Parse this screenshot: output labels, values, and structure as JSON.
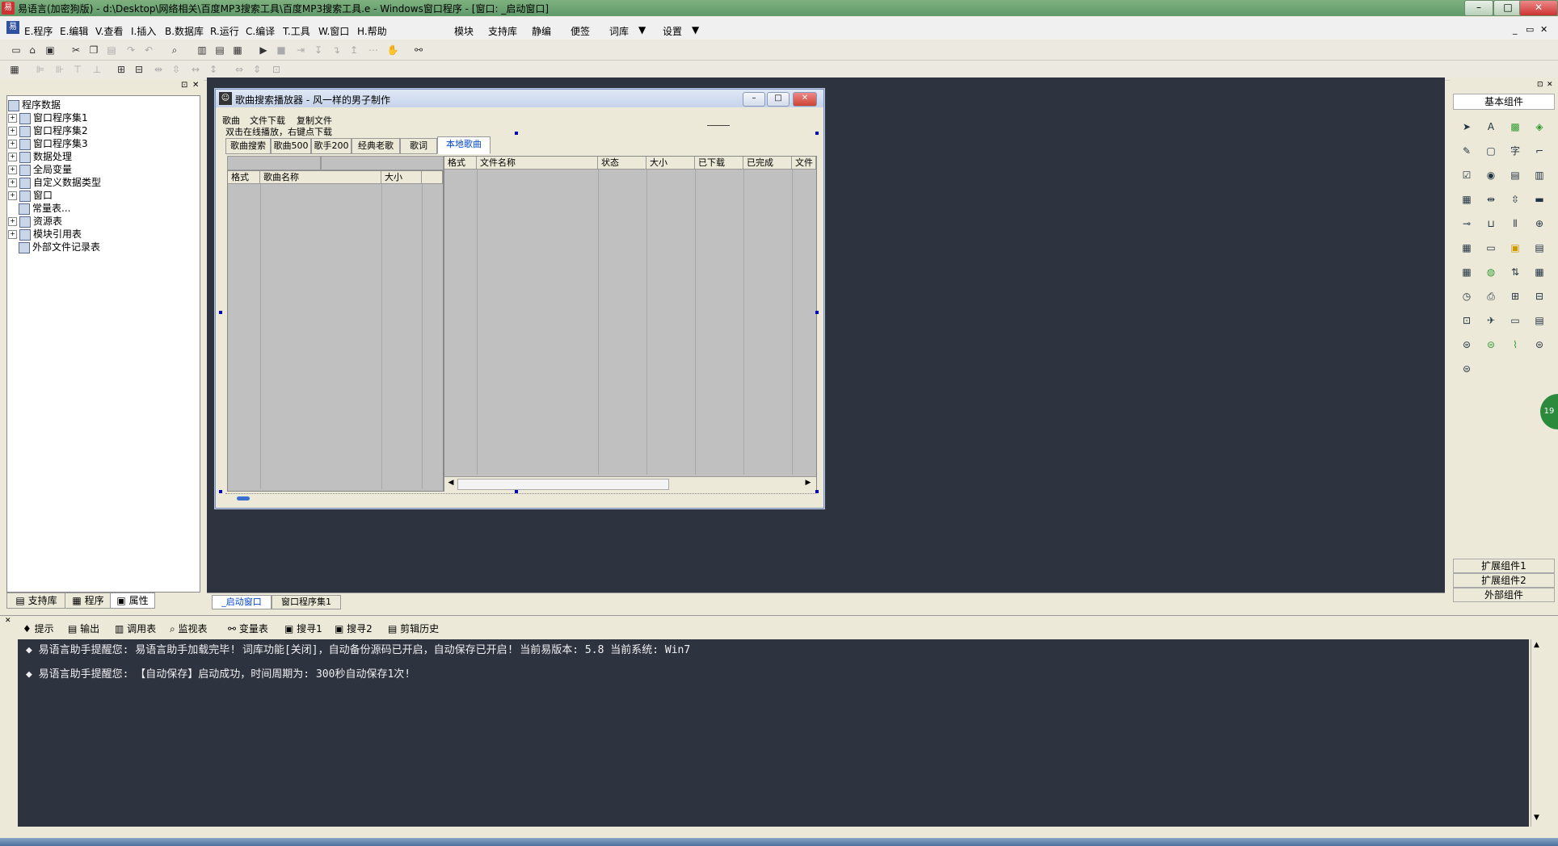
{
  "window": {
    "title": "易语言(加密狗版) - d:\\Desktop\\网络相关\\百度MP3搜索工具\\百度MP3搜索工具.e - Windows窗口程序 - [窗口: _启动窗口]",
    "app_icon_text": "易"
  },
  "menu": {
    "items": [
      "E.程序",
      "E.编辑",
      "V.查看",
      "I.插入",
      "B.数据库",
      "R.运行",
      "C.编译",
      "T.工具",
      "W.窗口",
      "H.帮助"
    ],
    "right_items": [
      "模块",
      "支持库",
      "静编",
      "便签",
      "词库",
      "设置"
    ]
  },
  "left_panel": {
    "tree": [
      {
        "label": "程序数据",
        "expand": ""
      },
      {
        "label": "窗口程序集1",
        "expand": "+"
      },
      {
        "label": "窗口程序集2",
        "expand": "+"
      },
      {
        "label": "窗口程序集3",
        "expand": "+"
      },
      {
        "label": "数据处理",
        "expand": "+"
      },
      {
        "label": "全局变量",
        "expand": "+"
      },
      {
        "label": "自定义数据类型",
        "expand": "+"
      },
      {
        "label": "窗口",
        "expand": "+"
      },
      {
        "label": "常量表...",
        "expand": ""
      },
      {
        "label": "资源表",
        "expand": "+"
      },
      {
        "label": "模块引用表",
        "expand": "+"
      },
      {
        "label": "外部文件记录表",
        "expand": ""
      }
    ],
    "tabs": [
      "支持库",
      "程序",
      "属性"
    ]
  },
  "designer": {
    "dialog_title": "歌曲搜索播放器 - 风一样的男子制作",
    "menu": [
      "歌曲",
      "文件下载",
      "复制文件"
    ],
    "hint": "双击在线播放，右键点下载",
    "tabs": [
      "歌曲搜索",
      "歌曲500",
      "歌手200",
      "经典老歌",
      "歌词",
      "本地歌曲"
    ],
    "active_tab": 5,
    "left_list_headers": [
      "格式",
      "歌曲名称",
      "大小"
    ],
    "right_list_headers": [
      "格式",
      "文件名称",
      "状态",
      "大小",
      "已下载",
      "已完成",
      "文件"
    ]
  },
  "editor_tabs": [
    "_启动窗口",
    "窗口程序集1"
  ],
  "right_panel": {
    "title": "基本组件",
    "bottom_buttons": [
      "扩展组件1",
      "扩展组件2",
      "外部组件"
    ],
    "side_badge": "19"
  },
  "bottom": {
    "tabs": [
      "提示",
      "输出",
      "调用表",
      "监视表",
      "变量表",
      "搜寻1",
      "搜寻2",
      "剪辑历史"
    ],
    "lines": [
      "易语言助手提醒您:  易语言助手加载完毕!  词库功能[关闭]，自动备份源码已开启，自动保存已开启!  当前易版本: 5.8  当前系统: Win7",
      "易语言助手提醒您: 【自动保存】启动成功，时间周期为: 300秒自动保存1次!"
    ]
  }
}
